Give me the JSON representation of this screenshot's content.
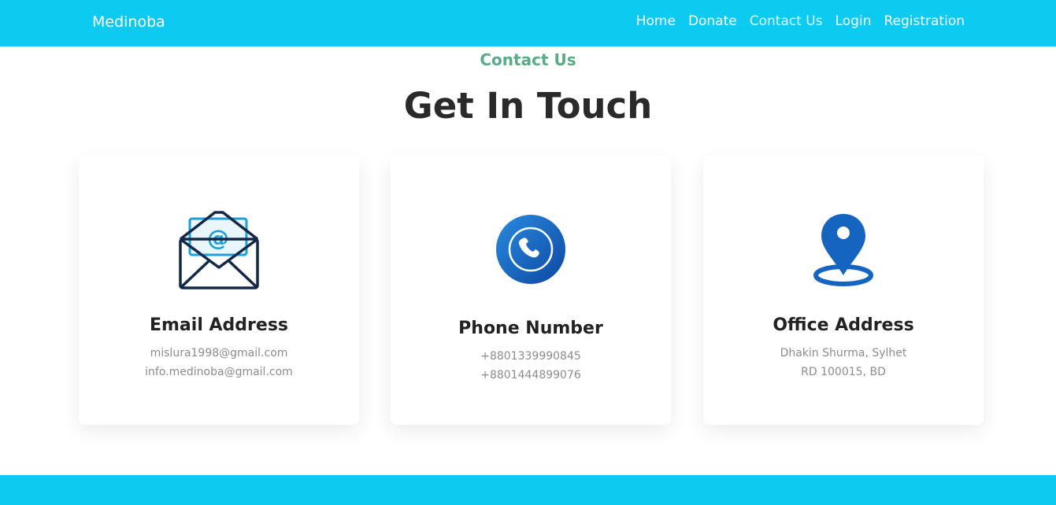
{
  "navbar": {
    "brand": "Medinoba",
    "links": [
      {
        "label": "Home"
      },
      {
        "label": "Donate"
      },
      {
        "label": "Contact Us"
      },
      {
        "label": "Login"
      },
      {
        "label": "Registration"
      }
    ]
  },
  "section": {
    "eyebrow": "Contact Us",
    "title": "Get In Touch"
  },
  "cards": [
    {
      "title": "Email Address",
      "lines": [
        "mislura1998@gmail.com",
        "info.medinoba@gmail.com"
      ],
      "icon": "envelope-icon"
    },
    {
      "title": "Phone Number",
      "lines": [
        "+8801339990845",
        "+8801444899076"
      ],
      "icon": "phone-icon"
    },
    {
      "title": "Office Address",
      "lines": [
        "Dhakin Shurma, Sylhet",
        "RD 100015, BD"
      ],
      "icon": "location-pin-icon"
    }
  ],
  "colors": {
    "primary": "#0dcaf0",
    "accent_green": "#5aab86",
    "icon_blue": "#1565c0"
  }
}
